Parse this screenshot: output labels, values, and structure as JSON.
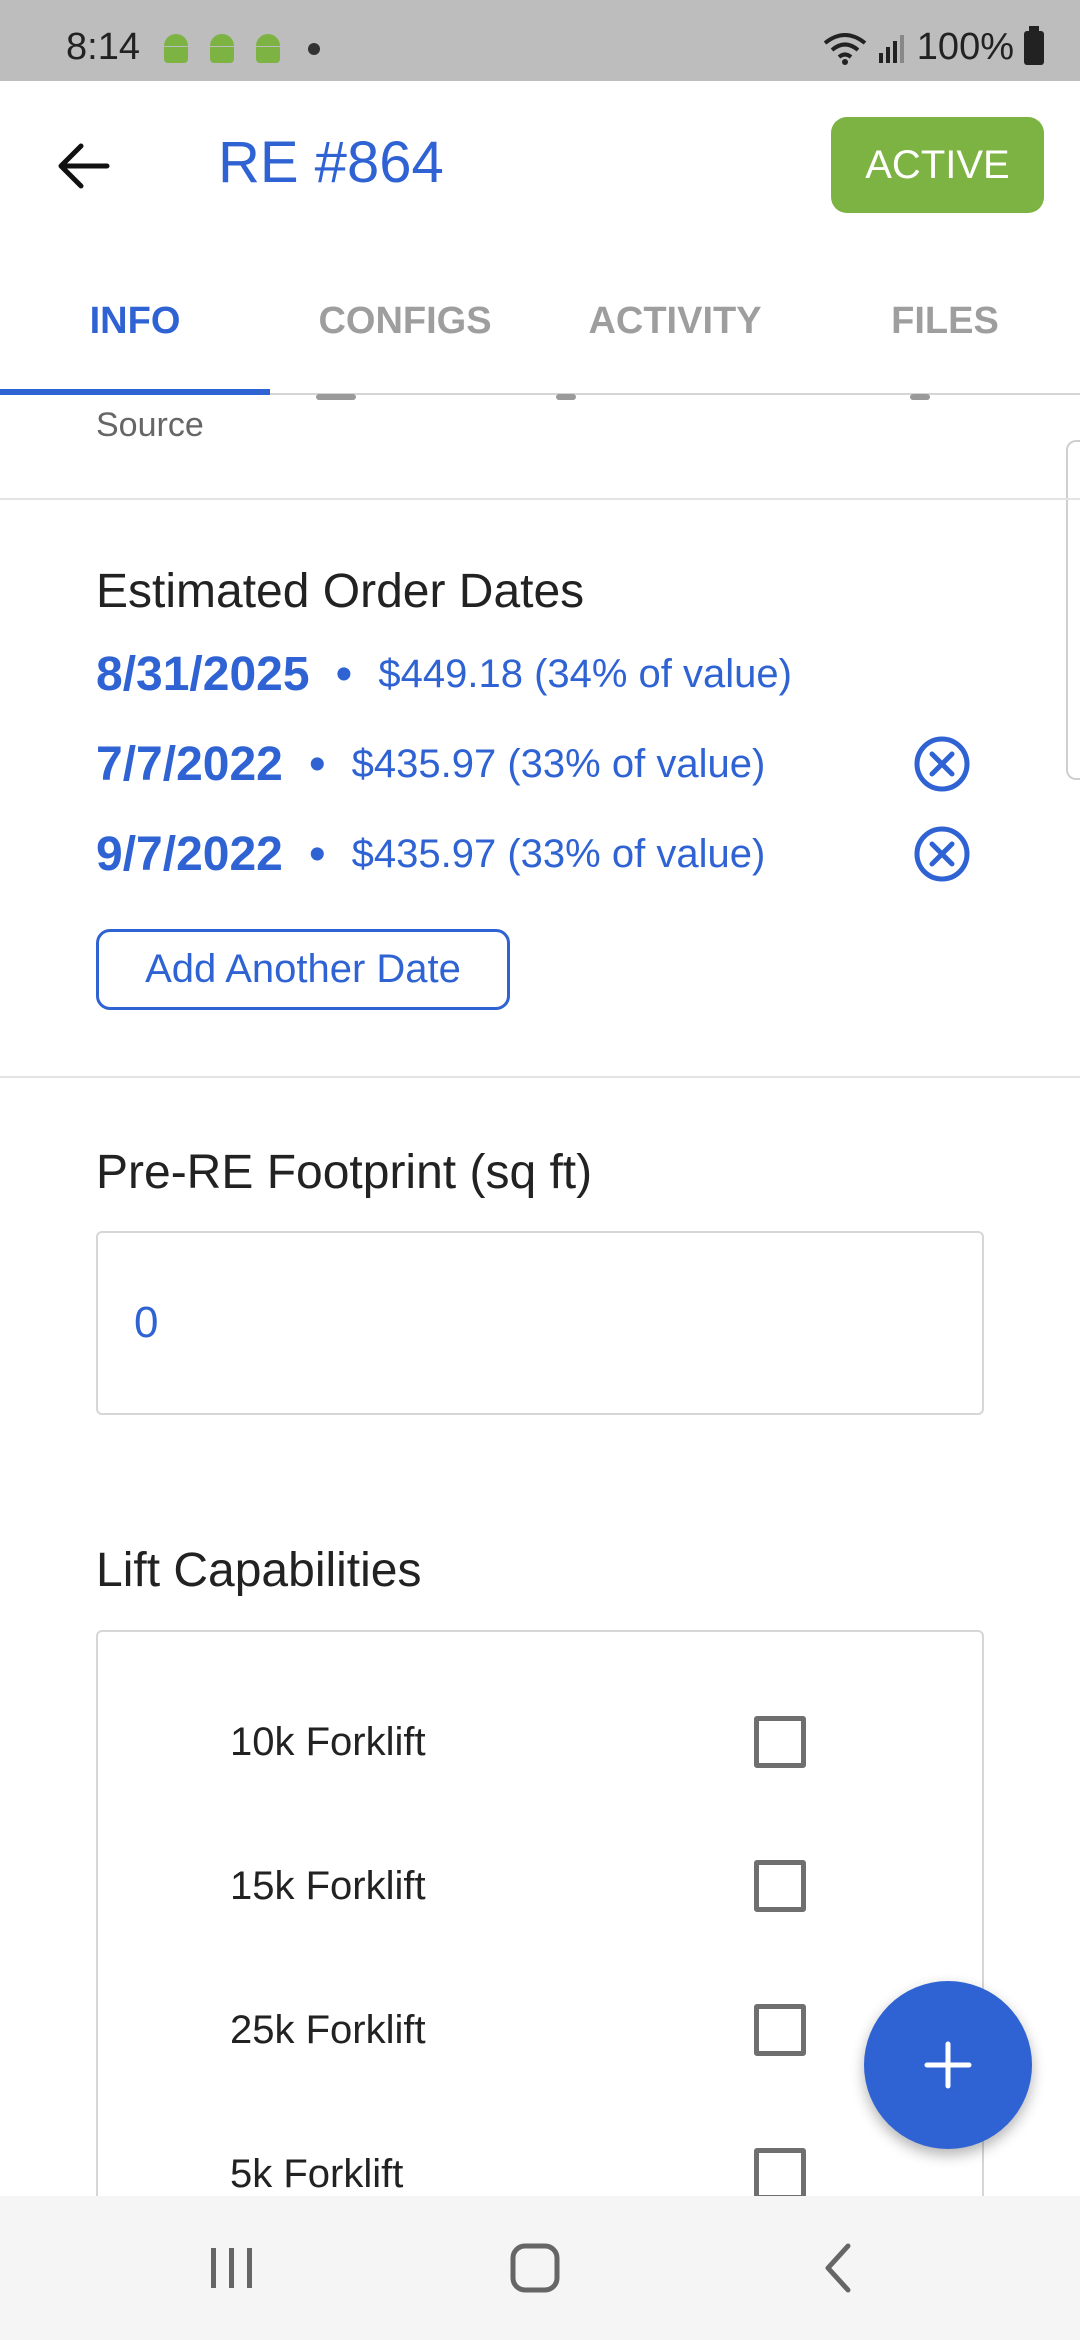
{
  "status_bar": {
    "time": "8:14",
    "battery": "100%"
  },
  "app_bar": {
    "title": "RE #864",
    "status": "ACTIVE",
    "status_color": "#7cb342",
    "accent_color": "#2f63d3"
  },
  "tabs": [
    {
      "label": "INFO",
      "active": true
    },
    {
      "label": "CONFIGS",
      "active": false
    },
    {
      "label": "ACTIVITY",
      "active": false
    },
    {
      "label": "FILES",
      "active": false
    }
  ],
  "partial_field": {
    "label": "Source"
  },
  "estimated_order_dates": {
    "title": "Estimated Order Dates",
    "separator": "•",
    "dates": [
      {
        "date": "8/31/2025",
        "amount": "$449.18 (34% of value)",
        "removable": false
      },
      {
        "date": "7/7/2022",
        "amount": "$435.97 (33% of value)",
        "removable": true
      },
      {
        "date": "9/7/2022",
        "amount": "$435.97 (33% of value)",
        "removable": true
      }
    ],
    "add_button_label": "Add Another Date"
  },
  "footprint": {
    "title": "Pre-RE Footprint (sq ft)",
    "value": "0"
  },
  "lift_capabilities": {
    "title": "Lift Capabilities",
    "items": [
      {
        "label": "10k Forklift",
        "checked": false
      },
      {
        "label": "15k Forklift",
        "checked": false
      },
      {
        "label": "25k Forklift",
        "checked": false
      },
      {
        "label": "5k Forklift",
        "checked": false
      }
    ]
  },
  "fab_icon": "plus-icon",
  "nav_bar": {
    "icons": [
      "recent-apps-icon",
      "home-icon",
      "back-icon"
    ]
  }
}
